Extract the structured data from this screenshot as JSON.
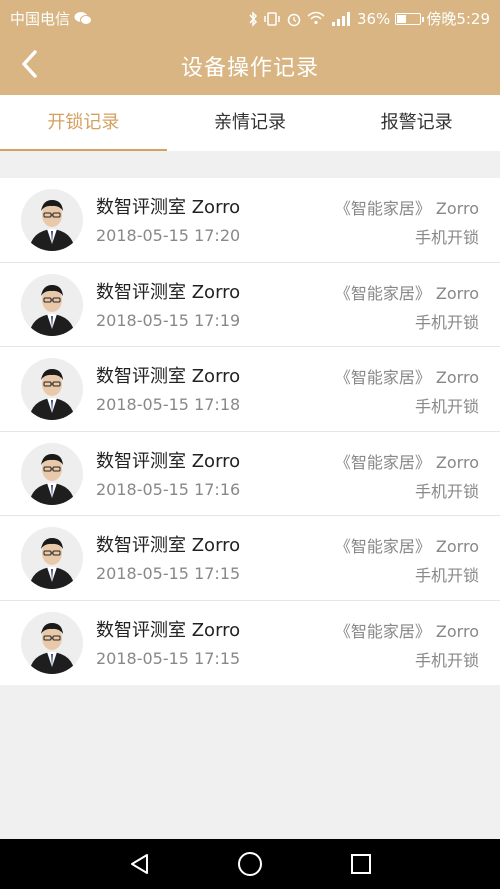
{
  "status_bar": {
    "carrier": "中国电信",
    "battery_text": "36%",
    "battery_level": 0.36,
    "time": "傍晚5:29",
    "icons": [
      "wechat-icon",
      "bluetooth-icon",
      "vibrate-icon",
      "alarm-icon",
      "wifi-icon",
      "signal-icon",
      "battery-icon"
    ]
  },
  "header": {
    "title": "设备操作记录",
    "back_icon": "chevron-left-icon"
  },
  "tabs": [
    {
      "label": "开锁记录",
      "active": true
    },
    {
      "label": "亲情记录",
      "active": false
    },
    {
      "label": "报警记录",
      "active": false
    }
  ],
  "records": [
    {
      "name": "数智评测室 Zorro",
      "time": "2018-05-15 17:20",
      "device": "《智能家居》 Zorro",
      "method": "手机开锁"
    },
    {
      "name": "数智评测室 Zorro",
      "time": "2018-05-15 17:19",
      "device": "《智能家居》 Zorro",
      "method": "手机开锁"
    },
    {
      "name": "数智评测室 Zorro",
      "time": "2018-05-15 17:18",
      "device": "《智能家居》 Zorro",
      "method": "手机开锁"
    },
    {
      "name": "数智评测室 Zorro",
      "time": "2018-05-15 17:16",
      "device": "《智能家居》 Zorro",
      "method": "手机开锁"
    },
    {
      "name": "数智评测室 Zorro",
      "time": "2018-05-15 17:15",
      "device": "《智能家居》 Zorro",
      "method": "手机开锁"
    },
    {
      "name": "数智评测室 Zorro",
      "time": "2018-05-15 17:15",
      "device": "《智能家居》 Zorro",
      "method": "手机开锁"
    }
  ],
  "navbar": {
    "icons": [
      "back-triangle-icon",
      "home-circle-icon",
      "recents-square-icon"
    ]
  },
  "colors": {
    "header_bg": "#d8b583",
    "accent": "#d4a160",
    "page_bg": "#f0f0f0"
  }
}
